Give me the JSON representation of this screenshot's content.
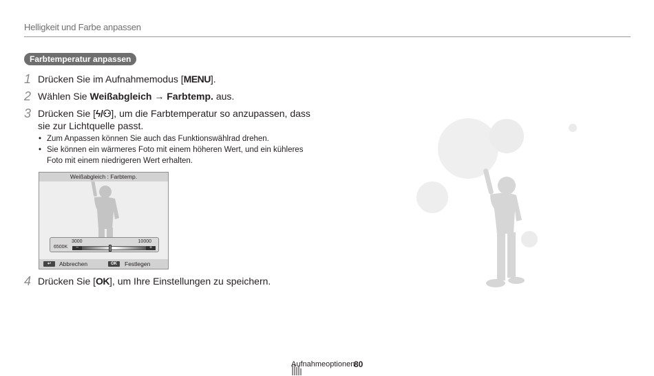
{
  "header": {
    "title": "Helligkeit und Farbe anpassen"
  },
  "section": {
    "title": "Farbtemperatur anpassen"
  },
  "steps": [
    {
      "num": "1",
      "pre": "Drücken Sie im Aufnahmemodus [",
      "key": "MENU",
      "post": "]."
    },
    {
      "num": "2",
      "pre": "Wählen Sie ",
      "bold1": "Weißabgleich",
      "arrow": " → ",
      "bold2": "Farbtemp.",
      "post": " aus."
    },
    {
      "num": "3",
      "pre": "Drücken Sie [",
      "key": "ϟ/⚇",
      "post": "], um die Farbtemperatur so anzupassen, dass sie zur Lichtquelle passt."
    },
    {
      "num": "4",
      "pre": "Drücken Sie [",
      "key": "OK",
      "post": "], um Ihre Einstellungen zu speichern."
    }
  ],
  "bullets": [
    "Zum Anpassen können Sie auch das Funktionswählrad drehen.",
    "Sie können ein wärmeres Foto mit einem höheren Wert, und ein kühleres Foto mit einem niedrigeren Wert erhalten."
  ],
  "camera_screen": {
    "title": "Weißabgleich : Farbtemp.",
    "slider": {
      "current": "6500K",
      "mid": "3000",
      "max": "10000",
      "minus": "−",
      "plus": "+",
      "position_fraction": 0.45
    },
    "footer": {
      "cancel_key": "↩",
      "cancel_label": "Abbrechen",
      "ok_key": "OK",
      "ok_label": "Festlegen"
    }
  },
  "footer": {
    "section": "Aufnahmeoptionen",
    "page": "80"
  },
  "icons": [
    "menu-key-icon",
    "flash-icon",
    "timer-icon",
    "ok-key-icon",
    "back-icon",
    "person-silhouette-icon"
  ]
}
